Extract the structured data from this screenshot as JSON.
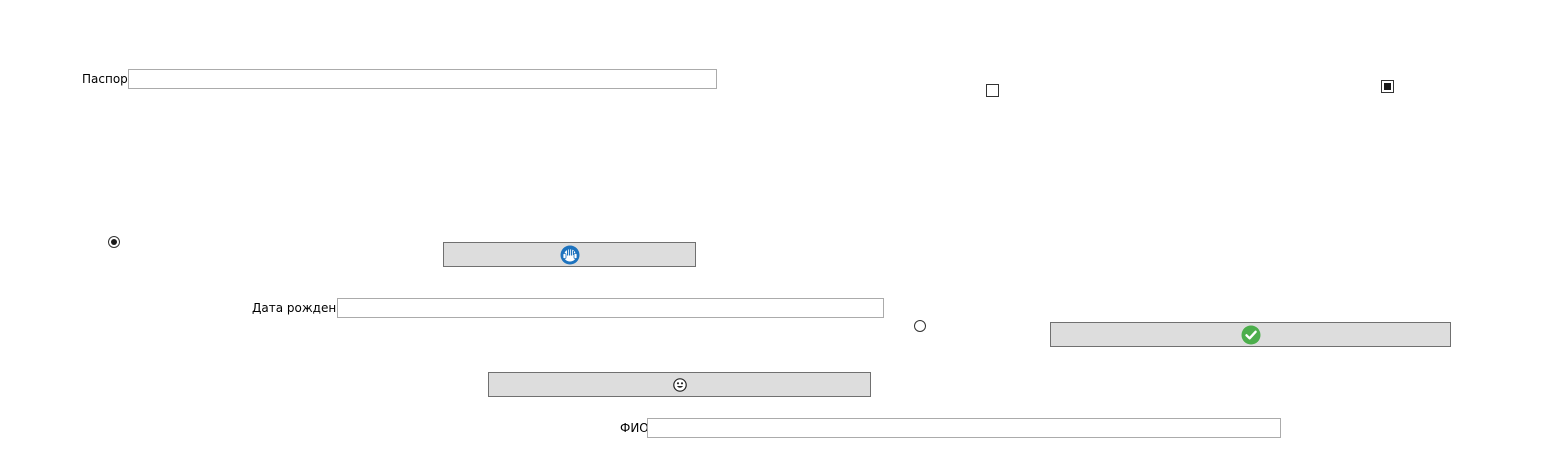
{
  "fields": {
    "passport": {
      "label": "Паспорт",
      "value": ""
    },
    "birth_date": {
      "label": "Дата рождения",
      "value": ""
    },
    "full_name": {
      "label": "ФИО",
      "value": ""
    }
  },
  "checkboxes": [
    {
      "checked": false
    },
    {
      "checked": true
    }
  ],
  "radios": [
    {
      "checked": true
    },
    {
      "checked": false
    }
  ],
  "buttons": [
    {
      "icon": "headset-emoji-icon",
      "color": "#1e73be"
    },
    {
      "icon": "checkmark-icon",
      "color": "#4cae4c"
    },
    {
      "icon": "smiley-face-icon",
      "color": "#222222"
    }
  ],
  "colors": {
    "button_face": "#dddddd",
    "field_border": "#ababab"
  }
}
